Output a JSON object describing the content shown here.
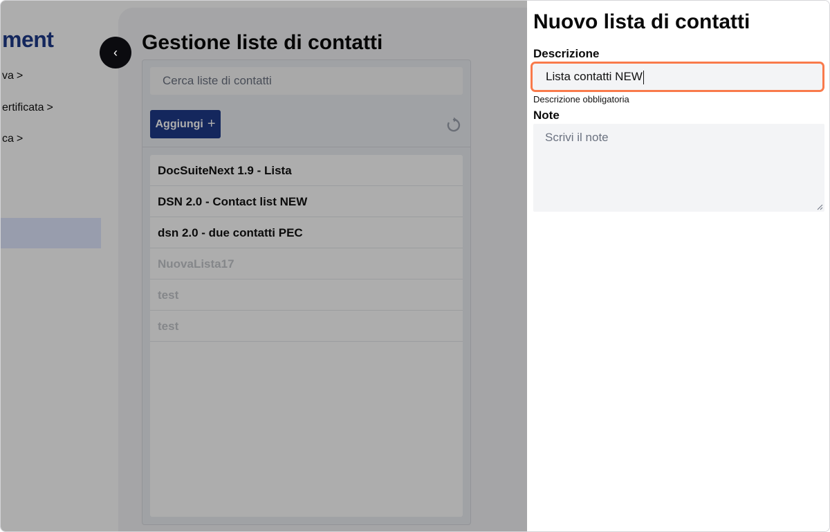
{
  "sidebar": {
    "brand": "ment",
    "items": [
      {
        "label": "va",
        "chevron": ">"
      },
      {
        "label": "ertificata",
        "chevron": ">"
      },
      {
        "label": "ca",
        "chevron": ">"
      }
    ]
  },
  "main": {
    "title": "Gestione liste di contatti",
    "search_placeholder": "Cerca liste di contatti",
    "add_label": "Aggiungi",
    "add_icon": "+",
    "collapse_icon": "‹",
    "lists": [
      {
        "label": "DocSuiteNext 1.9 - Lista",
        "muted": false
      },
      {
        "label": "DSN 2.0 - Contact list NEW",
        "muted": false
      },
      {
        "label": "dsn 2.0 - due contatti PEC",
        "muted": false
      },
      {
        "label": "NuovaLista17",
        "muted": true
      },
      {
        "label": "test",
        "muted": true
      },
      {
        "label": "test",
        "muted": true
      }
    ]
  },
  "drawer": {
    "title": "Nuovo lista di contatti",
    "description_label": "Descrizione",
    "description_value": "Lista contatti NEW",
    "description_hint": "Descrizione obbligatoria",
    "notes_label": "Note",
    "notes_placeholder": "Scrivi il note"
  },
  "colors": {
    "brand": "#1e3a8a",
    "focus_ring": "#f97a4b",
    "overlay": "rgba(0,0,0,0.32)"
  }
}
